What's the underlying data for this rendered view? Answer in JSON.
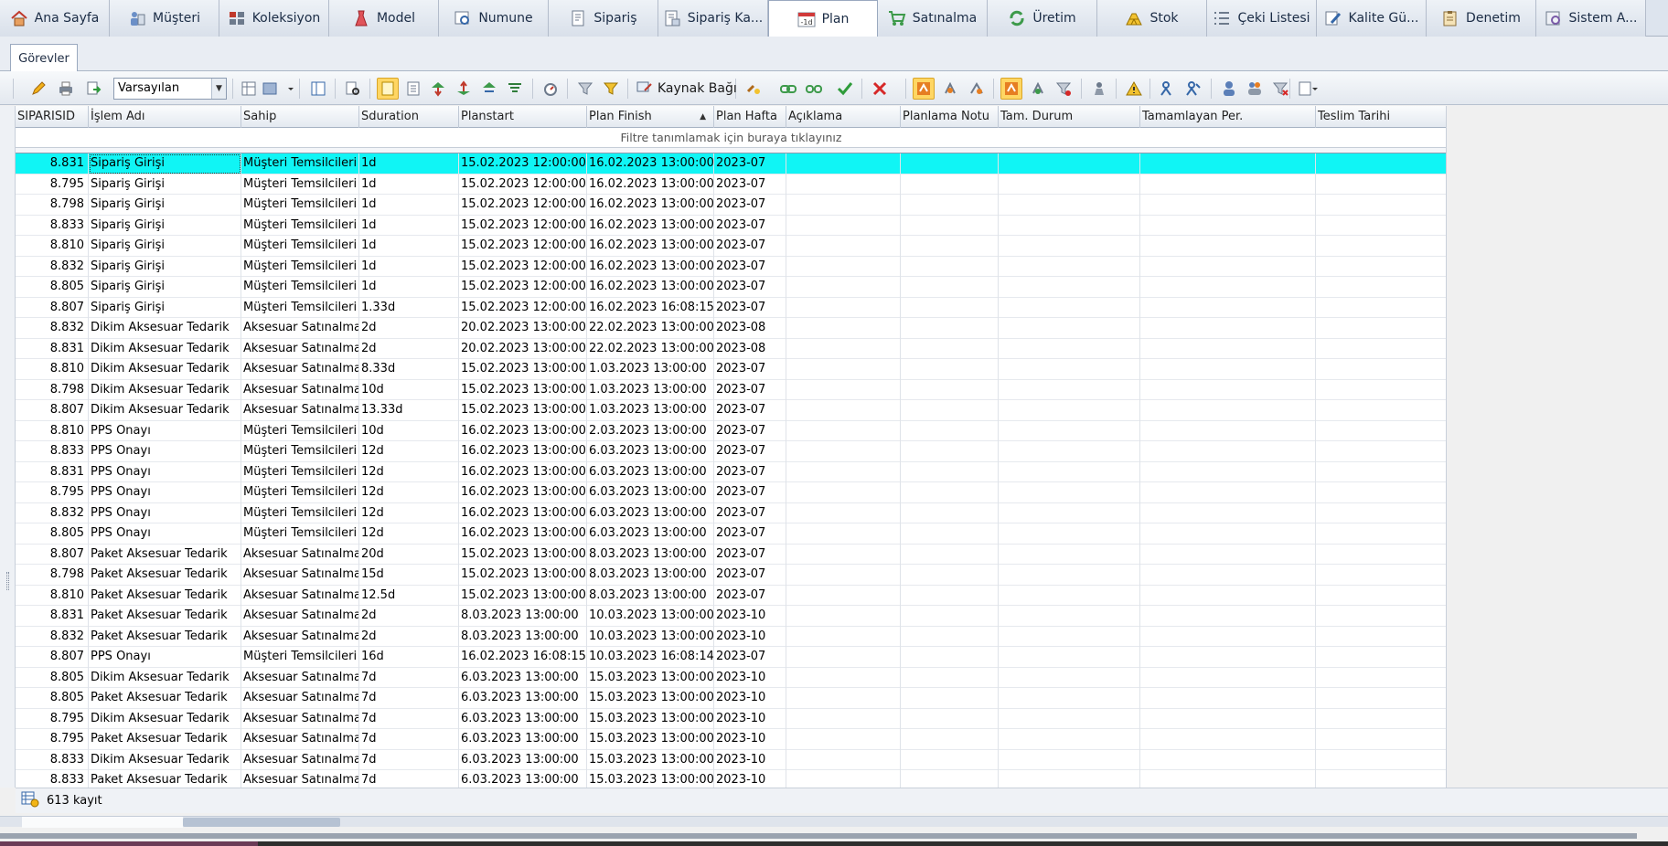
{
  "module_tabs": [
    {
      "label": "Ana Sayfa",
      "icon": "home-icon",
      "active": false
    },
    {
      "label": "Müşteri",
      "icon": "customer-icon",
      "active": false
    },
    {
      "label": "Koleksiyon",
      "icon": "collection-icon",
      "active": false
    },
    {
      "label": "Model",
      "icon": "dress-icon",
      "active": false
    },
    {
      "label": "Numune",
      "icon": "sample-icon",
      "active": false
    },
    {
      "label": "Sipariş",
      "icon": "order-icon",
      "active": false
    },
    {
      "label": "Sipariş Ka...",
      "icon": "order-card-icon",
      "active": false
    },
    {
      "label": "Plan",
      "icon": "calendar-icon",
      "active": true
    },
    {
      "label": "Satınalma",
      "icon": "cart-icon",
      "active": false
    },
    {
      "label": "Üretim",
      "icon": "production-icon",
      "active": false
    },
    {
      "label": "Stok",
      "icon": "gold-bars-icon",
      "active": false
    },
    {
      "label": "Çeki Listesi",
      "icon": "list-icon",
      "active": false
    },
    {
      "label": "Kalite Gü...",
      "icon": "quality-icon",
      "active": false
    },
    {
      "label": "Denetim",
      "icon": "clipboard-icon",
      "active": false
    },
    {
      "label": "Sistem A...",
      "icon": "system-settings-icon",
      "active": false
    }
  ],
  "sub_tab": "Görevler",
  "toolbar": {
    "layout_select": "Varsayılan",
    "kaynak_bagi": "Kaynak Bağı"
  },
  "grid": {
    "columns": [
      "SIPARISID",
      "İşlem Adı",
      "Sahip",
      "Sduration",
      "Planstart",
      "Plan Finish",
      "Plan Hafta",
      "Açıklama",
      "Planlama Notu",
      "Tam. Durum",
      "Tamamlayan Per.",
      "Teslim Tarihi"
    ],
    "sorted_column": "Plan Finish",
    "sort_direction": "ascending",
    "filter_hint": "Filtre tanımlamak için buraya tıklayınız",
    "selected_row": 0,
    "rows": [
      [
        "8.831",
        "Sipariş Girişi",
        "Müşteri Temsilcileri",
        "1d",
        "15.02.2023 12:00:00",
        "16.02.2023 13:00:00",
        "2023-07",
        "",
        "",
        "",
        "",
        ""
      ],
      [
        "8.795",
        "Sipariş Girişi",
        "Müşteri Temsilcileri",
        "1d",
        "15.02.2023 12:00:00",
        "16.02.2023 13:00:00",
        "2023-07",
        "",
        "",
        "",
        "",
        ""
      ],
      [
        "8.798",
        "Sipariş Girişi",
        "Müşteri Temsilcileri",
        "1d",
        "15.02.2023 12:00:00",
        "16.02.2023 13:00:00",
        "2023-07",
        "",
        "",
        "",
        "",
        ""
      ],
      [
        "8.833",
        "Sipariş Girişi",
        "Müşteri Temsilcileri",
        "1d",
        "15.02.2023 12:00:00",
        "16.02.2023 13:00:00",
        "2023-07",
        "",
        "",
        "",
        "",
        ""
      ],
      [
        "8.810",
        "Sipariş Girişi",
        "Müşteri Temsilcileri",
        "1d",
        "15.02.2023 12:00:00",
        "16.02.2023 13:00:00",
        "2023-07",
        "",
        "",
        "",
        "",
        ""
      ],
      [
        "8.832",
        "Sipariş Girişi",
        "Müşteri Temsilcileri",
        "1d",
        "15.02.2023 12:00:00",
        "16.02.2023 13:00:00",
        "2023-07",
        "",
        "",
        "",
        "",
        ""
      ],
      [
        "8.805",
        "Sipariş Girişi",
        "Müşteri Temsilcileri",
        "1d",
        "15.02.2023 12:00:00",
        "16.02.2023 13:00:00",
        "2023-07",
        "",
        "",
        "",
        "",
        ""
      ],
      [
        "8.807",
        "Sipariş Girişi",
        "Müşteri Temsilcileri",
        "1.33d",
        "15.02.2023 12:00:00",
        "16.02.2023 16:08:15",
        "2023-07",
        "",
        "",
        "",
        "",
        ""
      ],
      [
        "8.832",
        "Dikim Aksesuar Tedarik",
        "Aksesuar Satınalma",
        "2d",
        "20.02.2023 13:00:00",
        "22.02.2023 13:00:00",
        "2023-08",
        "",
        "",
        "",
        "",
        ""
      ],
      [
        "8.831",
        "Dikim Aksesuar Tedarik",
        "Aksesuar Satınalma",
        "2d",
        "20.02.2023 13:00:00",
        "22.02.2023 13:00:00",
        "2023-08",
        "",
        "",
        "",
        "",
        ""
      ],
      [
        "8.810",
        "Dikim Aksesuar Tedarik",
        "Aksesuar Satınalma",
        "8.33d",
        "15.02.2023 13:00:00",
        "1.03.2023 13:00:00",
        "2023-07",
        "",
        "",
        "",
        "",
        ""
      ],
      [
        "8.798",
        "Dikim Aksesuar Tedarik",
        "Aksesuar Satınalma",
        "10d",
        "15.02.2023 13:00:00",
        "1.03.2023 13:00:00",
        "2023-07",
        "",
        "",
        "",
        "",
        ""
      ],
      [
        "8.807",
        "Dikim Aksesuar Tedarik",
        "Aksesuar Satınalma",
        "13.33d",
        "15.02.2023 13:00:00",
        "1.03.2023 13:00:00",
        "2023-07",
        "",
        "",
        "",
        "",
        ""
      ],
      [
        "8.810",
        "PPS Onayı",
        "Müşteri Temsilcileri",
        "10d",
        "16.02.2023 13:00:00",
        "2.03.2023 13:00:00",
        "2023-07",
        "",
        "",
        "",
        "",
        ""
      ],
      [
        "8.833",
        "PPS Onayı",
        "Müşteri Temsilcileri",
        "12d",
        "16.02.2023 13:00:00",
        "6.03.2023 13:00:00",
        "2023-07",
        "",
        "",
        "",
        "",
        ""
      ],
      [
        "8.831",
        "PPS Onayı",
        "Müşteri Temsilcileri",
        "12d",
        "16.02.2023 13:00:00",
        "6.03.2023 13:00:00",
        "2023-07",
        "",
        "",
        "",
        "",
        ""
      ],
      [
        "8.795",
        "PPS Onayı",
        "Müşteri Temsilcileri",
        "12d",
        "16.02.2023 13:00:00",
        "6.03.2023 13:00:00",
        "2023-07",
        "",
        "",
        "",
        "",
        ""
      ],
      [
        "8.832",
        "PPS Onayı",
        "Müşteri Temsilcileri",
        "12d",
        "16.02.2023 13:00:00",
        "6.03.2023 13:00:00",
        "2023-07",
        "",
        "",
        "",
        "",
        ""
      ],
      [
        "8.805",
        "PPS Onayı",
        "Müşteri Temsilcileri",
        "12d",
        "16.02.2023 13:00:00",
        "6.03.2023 13:00:00",
        "2023-07",
        "",
        "",
        "",
        "",
        ""
      ],
      [
        "8.807",
        "Paket Aksesuar Tedarik",
        "Aksesuar Satınalma",
        "20d",
        "15.02.2023 13:00:00",
        "8.03.2023 13:00:00",
        "2023-07",
        "",
        "",
        "",
        "",
        ""
      ],
      [
        "8.798",
        "Paket Aksesuar Tedarik",
        "Aksesuar Satınalma",
        "15d",
        "15.02.2023 13:00:00",
        "8.03.2023 13:00:00",
        "2023-07",
        "",
        "",
        "",
        "",
        ""
      ],
      [
        "8.810",
        "Paket Aksesuar Tedarik",
        "Aksesuar Satınalma",
        "12.5d",
        "15.02.2023 13:00:00",
        "8.03.2023 13:00:00",
        "2023-07",
        "",
        "",
        "",
        "",
        ""
      ],
      [
        "8.831",
        "Paket Aksesuar Tedarik",
        "Aksesuar Satınalma",
        "2d",
        "8.03.2023 13:00:00",
        "10.03.2023 13:00:00",
        "2023-10",
        "",
        "",
        "",
        "",
        ""
      ],
      [
        "8.832",
        "Paket Aksesuar Tedarik",
        "Aksesuar Satınalma",
        "2d",
        "8.03.2023 13:00:00",
        "10.03.2023 13:00:00",
        "2023-10",
        "",
        "",
        "",
        "",
        ""
      ],
      [
        "8.807",
        "PPS Onayı",
        "Müşteri Temsilcileri",
        "16d",
        "16.02.2023 16:08:15",
        "10.03.2023 16:08:14",
        "2023-07",
        "",
        "",
        "",
        "",
        ""
      ],
      [
        "8.805",
        "Dikim Aksesuar Tedarik",
        "Aksesuar Satınalma",
        "7d",
        "6.03.2023 13:00:00",
        "15.03.2023 13:00:00",
        "2023-10",
        "",
        "",
        "",
        "",
        ""
      ],
      [
        "8.805",
        "Paket Aksesuar Tedarik",
        "Aksesuar Satınalma",
        "7d",
        "6.03.2023 13:00:00",
        "15.03.2023 13:00:00",
        "2023-10",
        "",
        "",
        "",
        "",
        ""
      ],
      [
        "8.795",
        "Dikim Aksesuar Tedarik",
        "Aksesuar Satınalma",
        "7d",
        "6.03.2023 13:00:00",
        "15.03.2023 13:00:00",
        "2023-10",
        "",
        "",
        "",
        "",
        ""
      ],
      [
        "8.795",
        "Paket Aksesuar Tedarik",
        "Aksesuar Satınalma",
        "7d",
        "6.03.2023 13:00:00",
        "15.03.2023 13:00:00",
        "2023-10",
        "",
        "",
        "",
        "",
        ""
      ],
      [
        "8.833",
        "Dikim Aksesuar Tedarik",
        "Aksesuar Satınalma",
        "7d",
        "6.03.2023 13:00:00",
        "15.03.2023 13:00:00",
        "2023-10",
        "",
        "",
        "",
        "",
        ""
      ],
      [
        "8.833",
        "Paket Aksesuar Tedarik",
        "Aksesuar Satınalma",
        "7d",
        "6.03.2023 13:00:00",
        "15.03.2023 13:00:00",
        "2023-10",
        "",
        "",
        "",
        "",
        ""
      ]
    ]
  },
  "footer": {
    "record_count": "613 kayıt"
  },
  "colors": {
    "selected_row": "#10f5f5",
    "accent_toggle": "#ffd663"
  }
}
